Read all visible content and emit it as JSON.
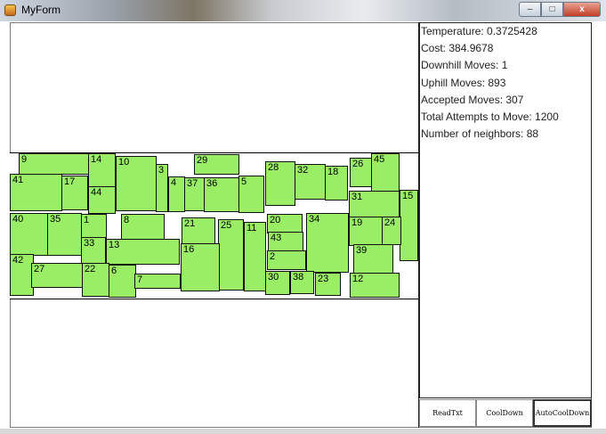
{
  "window": {
    "title": "MyForm",
    "minimize": "–",
    "maximize": "□",
    "close": "x"
  },
  "stats": [
    "Temperature: 0.3725428",
    "Cost: 384.9678",
    "Downhill Moves: 1",
    "Uphill Moves: 893",
    "Accepted Moves: 307",
    "Total Attempts to Move: 1200",
    "Number of neighbors: 88"
  ],
  "buttons": {
    "read": "ReadTxt",
    "cool": "CoolDown",
    "auto": "AutoCoolDown"
  },
  "blocks": {
    "b1": "1",
    "b2": "2",
    "b3": "3",
    "b4": "4",
    "b5": "5",
    "b6": "6",
    "b7": "7",
    "b8": "8",
    "b9": "9",
    "b10": "10",
    "b11": "11",
    "b12": "12",
    "b13": "13",
    "b14": "14",
    "b15": "15",
    "b16": "16",
    "b17": "17",
    "b18": "18",
    "b19": "19",
    "b20": "20",
    "b21": "21",
    "b22": "22",
    "b23": "23",
    "b24": "24",
    "b25": "25",
    "b26": "26",
    "b27": "27",
    "b28": "28",
    "b29": "29",
    "b30": "30",
    "b31": "31",
    "b32": "32",
    "b33": "33",
    "b34": "34",
    "b35": "35",
    "b36": "36",
    "b37": "37",
    "b38": "38",
    "b39": "39",
    "b40": "40",
    "b41": "41",
    "b42": "42",
    "b43": "43",
    "b44": "44",
    "b45": "45"
  },
  "colors": {
    "block_fill": "#99ee66",
    "block_border": "#111111"
  }
}
